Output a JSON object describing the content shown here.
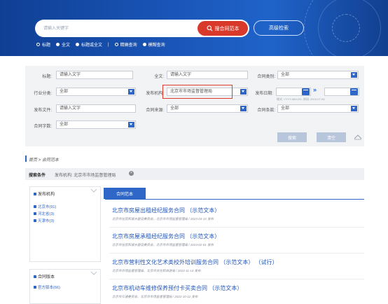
{
  "header": {
    "search_placeholder": "请输入关键字",
    "search_button": "搜合同范本",
    "advanced_button": "高级检索",
    "modes": [
      {
        "label": "标题",
        "selected": false
      },
      {
        "label": "全文",
        "selected": true
      },
      {
        "label": "标题或全文",
        "selected": true
      },
      {
        "label": "精确查询",
        "selected": false
      },
      {
        "label": "模糊查询",
        "selected": true
      }
    ],
    "separator": "|"
  },
  "filters": {
    "title_label": "标题:",
    "title_placeholder": "请输入文字",
    "fulltext_label": "全文:",
    "fulltext_placeholder": "请输入文字",
    "category_label": "合同类别:",
    "category_value": "全部",
    "industry_label": "行业分类:",
    "industry_value": "全部",
    "agency_label": "发布机构:",
    "agency_value": "北京市市场监督管理局",
    "date_label": "发布日期:",
    "date_hint": "格式: YYYY-MM-DD, 例如: 2015-07-06",
    "docno_label": "发布文件:",
    "docno_placeholder": "请输入文字",
    "source_label": "合同来源:",
    "source_value": "全部",
    "clauses_label": "合同条款:",
    "clauses_value": "全部",
    "wordcount_label": "合同字数:",
    "wordcount_value": "全部",
    "search_button": "搜索",
    "clear_button": "清空"
  },
  "breadcrumb": "首页 > 合同范本",
  "conditions": {
    "title": "搜索条件",
    "text": "发布机构: 北京市市场监督管理局",
    "remove": "×"
  },
  "facets": [
    {
      "title": "发布机构",
      "items": [
        "北京市(91)",
        "河北省(3)",
        "天津市(3)"
      ]
    },
    {
      "title": "合同版本",
      "items": [
        "官方版本(66)"
      ]
    }
  ],
  "results_tab": "合同范本",
  "results": [
    {
      "title": "北京市房屋出租经纪服务合同 （示范文本）",
      "meta": "北京市住房和城乡建设委员会、北京市市场监督管理局 / 2023-03-15 发布"
    },
    {
      "title": "北京市房屋承租经纪服务合同 （示范文本）",
      "meta": "北京市住房和城乡建设委员会、北京市市场监督管理局 / 2023-02-01 发布"
    },
    {
      "title": "北京市营利性文化艺术类校外培训服务合同 （示范文本） （试行）",
      "meta": "北京市市场监督管理局、北京市文化和旅游局 / 2022-11-14 发布"
    },
    {
      "title": "北京市机动车维修保养预付卡买卖合同 （示范文本）",
      "meta": "北京市交通委员会、北京市市场监督管理局 / 2022-10-12 发布"
    }
  ],
  "colors": {
    "brand_blue": "#1a56b8",
    "accent_red": "#d9392b",
    "link": "#2457b8"
  }
}
